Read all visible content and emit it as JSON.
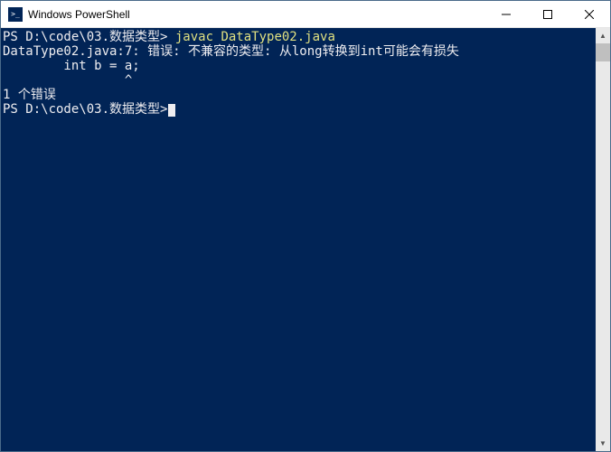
{
  "window": {
    "title": "Windows PowerShell"
  },
  "terminal": {
    "lines": [
      {
        "prompt": "PS D:\\code\\03.数据类型>",
        "command": " javac DataType02.java"
      },
      {
        "text": "DataType02.java:7: 错误: 不兼容的类型: 从long转换到int可能会有损失"
      },
      {
        "text": "        int b = a;"
      },
      {
        "text": "                ^"
      },
      {
        "text": "1 个错误"
      },
      {
        "prompt": "PS D:\\code\\03.数据类型>",
        "cursor": true
      }
    ]
  }
}
